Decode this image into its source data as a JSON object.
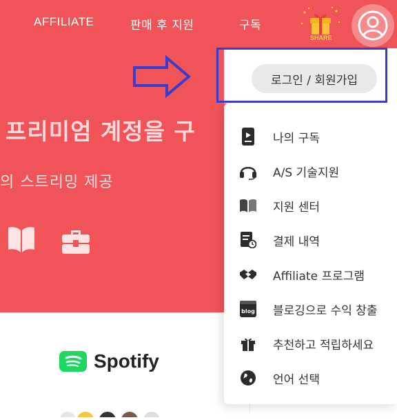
{
  "nav": {
    "affiliate": "AFFILIATE",
    "aftersales": "판매 후 지원",
    "subscribe": "구독",
    "share_label": "SHARE"
  },
  "hero": {
    "title": "프리미엄 계정을 구",
    "subtitle": "의 스트리밍 제공"
  },
  "login": {
    "button": "로그인 / 회원가입"
  },
  "menu": [
    {
      "icon": "phone-icon",
      "label": "나의 구독"
    },
    {
      "icon": "headset-icon",
      "label": "A/S 기술지원"
    },
    {
      "icon": "book-icon",
      "label": "지원 센터"
    },
    {
      "icon": "receipt-icon",
      "label": "결제 내역"
    },
    {
      "icon": "handshake-icon",
      "label": "Affiliate 프로그램"
    },
    {
      "icon": "blog-icon",
      "label": "블로깅으로 수익 창출"
    },
    {
      "icon": "gift-icon",
      "label": "추천하고 적립하세요"
    },
    {
      "icon": "globe-icon",
      "label": "언어 선택"
    }
  ],
  "brand": {
    "spotify": "Spotify"
  },
  "colors": {
    "hero_bg": "#f05458",
    "highlight": "#3a3ccc",
    "spotify_green": "#1ed760"
  }
}
